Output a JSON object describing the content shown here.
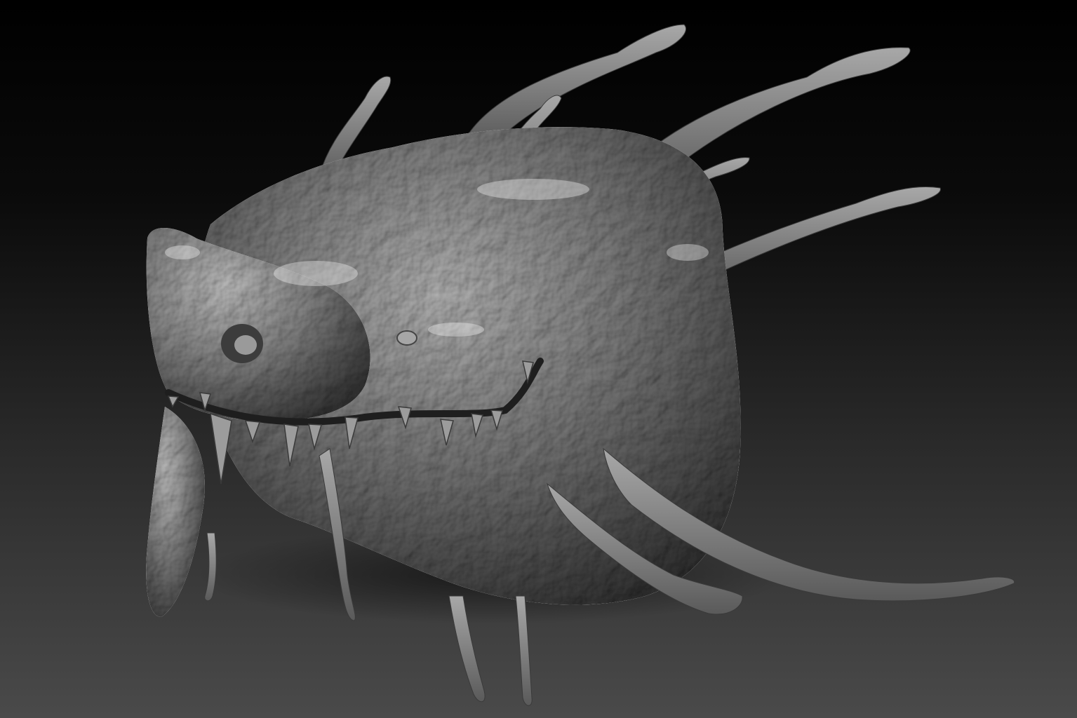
{
  "viewport": {
    "background_top": "#000000",
    "background_bottom": "#4a4a4a"
  },
  "model": {
    "subject": "creature-head-sculpt",
    "material_color": "#8a8a8a"
  }
}
